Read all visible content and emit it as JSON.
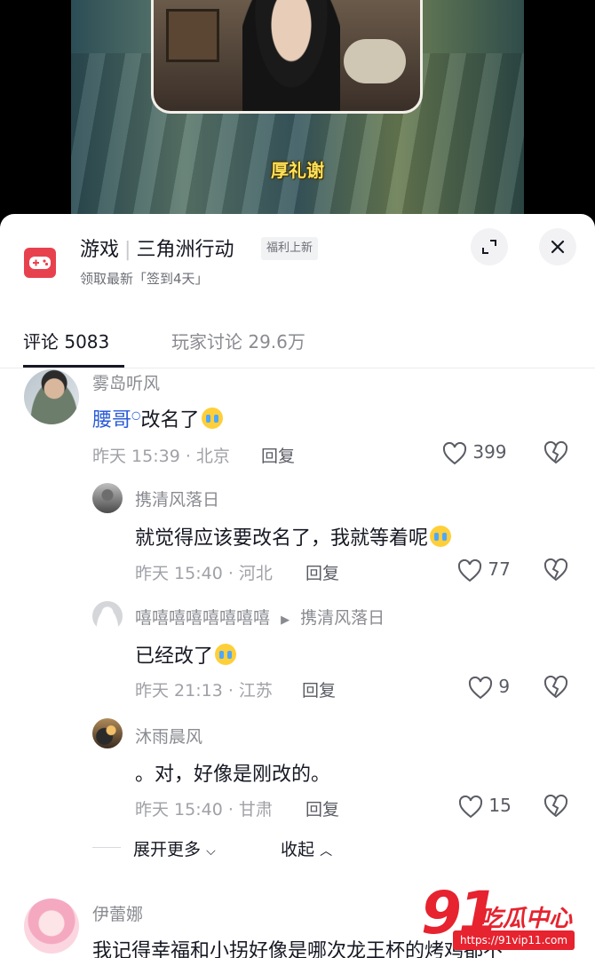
{
  "video": {
    "caption": "厚礼谢"
  },
  "game": {
    "category": "游戏",
    "name": "三角洲行动",
    "badge": "福利上新",
    "subtitle": "领取最新「签到4天」"
  },
  "tabs": [
    {
      "label": "评论 5083"
    },
    {
      "label": "玩家讨论 29.6万"
    }
  ],
  "comments": [
    {
      "user": "雾岛听风",
      "mention": "腰哥",
      "text": "改名了",
      "time_location": "昨天 15:39 · 北京",
      "reply_label": "回复",
      "likes": "399"
    }
  ],
  "replies": [
    {
      "user": "携清风落日",
      "text": "就觉得应该要改名了，我就等着呢",
      "time_location": "昨天 15:40 · 河北",
      "reply_label": "回复",
      "likes": "77"
    },
    {
      "user": "嘻嘻嘻嘻嘻嘻嘻嘻",
      "reply_to": "携清风落日",
      "text": "已经改了",
      "time_location": "昨天 21:13 · 江苏",
      "reply_label": "回复",
      "likes": "9"
    },
    {
      "user": "沐雨晨风",
      "text": "。对，好像是刚改的。",
      "time_location": "昨天 15:40 · 甘肃",
      "reply_label": "回复",
      "likes": "15"
    }
  ],
  "expand_label": "展开更多",
  "collapse_label": "收起",
  "next_comment": {
    "user": "伊蕾娜",
    "text": "我记得幸福和小拐好像是哪次龙王杯的烤鸡都不"
  },
  "watermark": {
    "logo": "91",
    "brand": "吃瓜中心",
    "url": "https://91vip11.com"
  },
  "colors": {
    "accent_red": "#e8414e",
    "mention_blue": "#2a5bd7"
  }
}
